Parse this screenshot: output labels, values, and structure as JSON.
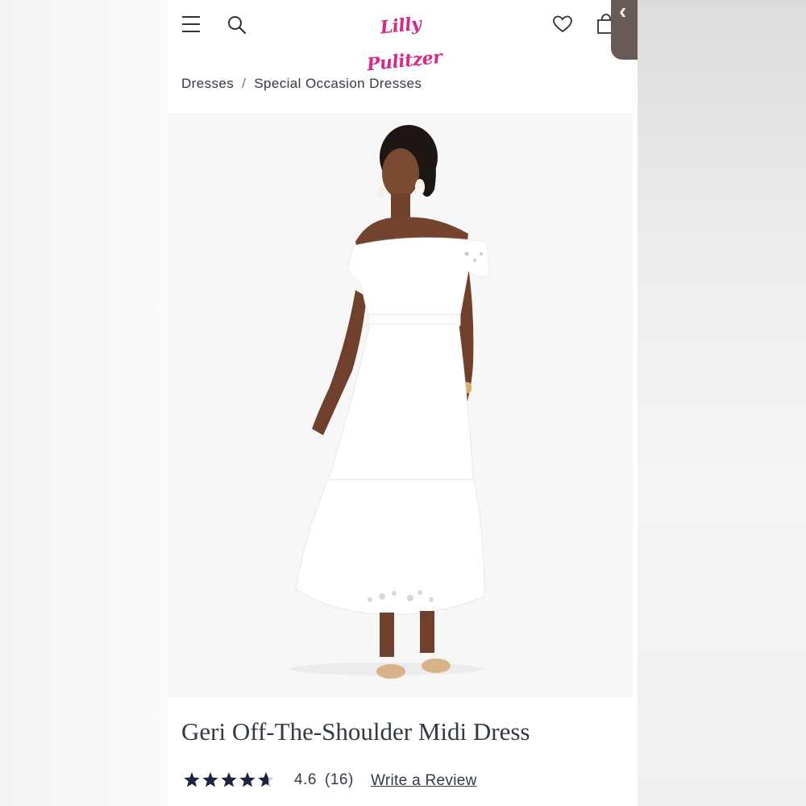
{
  "header": {
    "logo_text": "Lilly Pulitzer",
    "icons": [
      "menu-icon",
      "search-icon",
      "heart-icon",
      "shopping-bag-icon",
      "chevron-left-icon"
    ]
  },
  "breadcrumb": {
    "items": [
      "Dresses",
      "Special Occasion Dresses"
    ],
    "separator": "/"
  },
  "product": {
    "image_alt": "Model wearing white off-the-shoulder eyelet midi dress",
    "title": "Geri Off-The-Shoulder Midi Dress",
    "rating_value": "4.6",
    "review_count": "(16)",
    "write_review_label": "Write a Review",
    "stars": 4.6
  },
  "colors": {
    "brand_pink": "#d52a8a",
    "text_dark": "#333a44",
    "star_navy": "#1c2440",
    "tab_brown": "#6b5b57"
  }
}
